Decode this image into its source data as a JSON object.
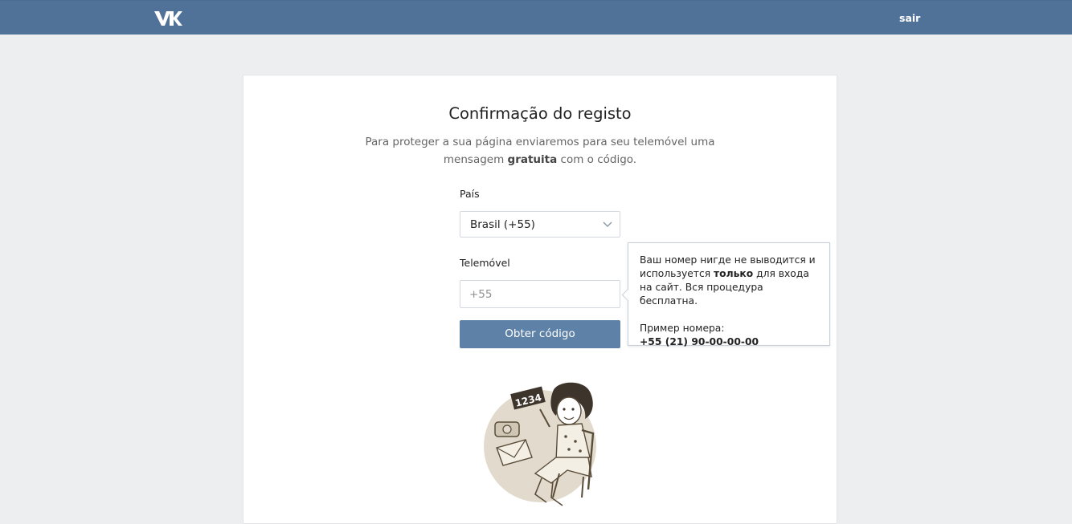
{
  "colors": {
    "header": "#507299",
    "button": "#5e81a8",
    "background": "#edeef0"
  },
  "header": {
    "logo_icon": "vk-logo-icon",
    "logout_label": "sair"
  },
  "main": {
    "title": "Confirmação do registo",
    "description_part1": "Para proteger a sua página enviaremos para seu telemóvel uma mensagem ",
    "description_bold": "gratuita",
    "description_part2": " com o código.",
    "country_label": "País",
    "country_value": "Brasil (+55)",
    "phone_label": "Telemóvel",
    "phone_placeholder": "+55",
    "submit_label": "Obter código"
  },
  "tooltip": {
    "text_part1": "Ваш номер нигде не выводится и используется ",
    "text_bold": "только",
    "text_part2": " для входа на сайт. Вся процедура бесплатна.",
    "example_label": "Пример номера:",
    "example_value": "+55 (21) 90-00-00-00"
  },
  "illustration": {
    "sign_text": "1234"
  }
}
